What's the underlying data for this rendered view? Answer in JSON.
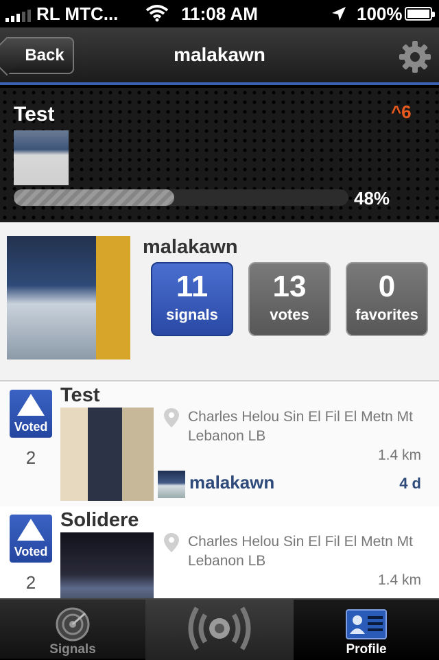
{
  "status_bar": {
    "carrier": "RL MTC...",
    "time": "11:08 AM",
    "battery": "100%"
  },
  "nav": {
    "back_label": "Back",
    "title": "malakawn"
  },
  "signal_panel": {
    "title": "Test",
    "votes": "^6",
    "progress_percent": 48,
    "progress_label": "48%"
  },
  "profile": {
    "name": "malakawn",
    "stats": [
      {
        "value": "11",
        "label": "signals",
        "active": true
      },
      {
        "value": "13",
        "label": "votes",
        "active": false
      },
      {
        "value": "0",
        "label": "favorites",
        "active": false
      }
    ]
  },
  "signals": [
    {
      "title": "Test",
      "vote_label": "Voted",
      "vote_count": "2",
      "address": "Charles Helou Sin El Fil El Metn Mt Lebanon LB",
      "distance": "1.4 km",
      "user": "malakawn",
      "age": "4 d"
    },
    {
      "title": "Solidere",
      "vote_label": "Voted",
      "vote_count": "2",
      "address": "Charles Helou Sin El Fil El Metn Mt Lebanon LB",
      "distance": "1.4 km"
    }
  ],
  "tabbar": {
    "signals_label": "Signals",
    "profile_label": "Profile"
  },
  "colors": {
    "accent_blue": "#2a49a5",
    "vote_orange": "#e85a1e",
    "username_blue": "#2e4a7a"
  }
}
